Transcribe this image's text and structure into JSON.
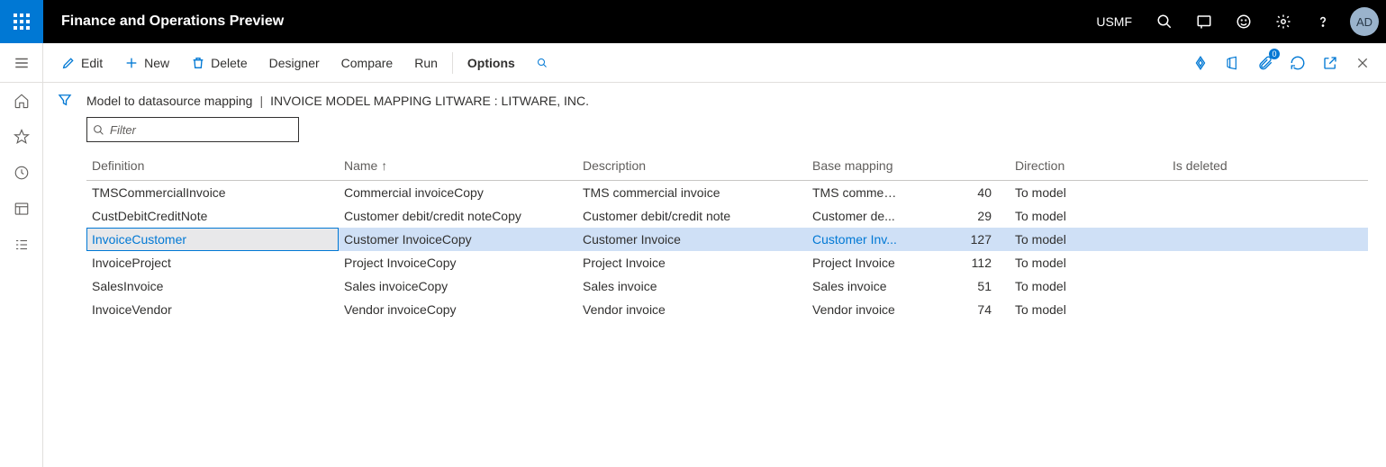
{
  "header": {
    "app_title": "Finance and Operations Preview",
    "company": "USMF",
    "avatar": "AD"
  },
  "cmd": {
    "edit": "Edit",
    "new": "New",
    "delete": "Delete",
    "designer": "Designer",
    "compare": "Compare",
    "run": "Run",
    "options": "Options",
    "attach_badge": "0"
  },
  "breadcrumb": {
    "page": "Model to datasource mapping",
    "detail": "INVOICE MODEL MAPPING LITWARE : LITWARE, INC."
  },
  "filter": {
    "placeholder": "Filter"
  },
  "columns": {
    "definition": "Definition",
    "name": "Name",
    "description": "Description",
    "base_mapping": "Base mapping",
    "direction": "Direction",
    "is_deleted": "Is deleted"
  },
  "rows": [
    {
      "definition": "TMSCommercialInvoice",
      "name": "Commercial invoiceCopy",
      "description": "TMS commercial invoice",
      "base_mapping": "TMS commer...",
      "num": "40",
      "direction": "To model",
      "selected": false
    },
    {
      "definition": "CustDebitCreditNote",
      "name": "Customer debit/credit noteCopy",
      "description": "Customer debit/credit note",
      "base_mapping": "Customer de...",
      "num": "29",
      "direction": "To model",
      "selected": false
    },
    {
      "definition": "InvoiceCustomer",
      "name": "Customer InvoiceCopy",
      "description": "Customer Invoice",
      "base_mapping": "Customer Inv...",
      "num": "127",
      "direction": "To model",
      "selected": true
    },
    {
      "definition": "InvoiceProject",
      "name": "Project InvoiceCopy",
      "description": "Project Invoice",
      "base_mapping": "Project Invoice",
      "num": "112",
      "direction": "To model",
      "selected": false
    },
    {
      "definition": "SalesInvoice",
      "name": "Sales invoiceCopy",
      "description": "Sales invoice",
      "base_mapping": "Sales invoice",
      "num": "51",
      "direction": "To model",
      "selected": false
    },
    {
      "definition": "InvoiceVendor",
      "name": "Vendor invoiceCopy",
      "description": "Vendor invoice",
      "base_mapping": "Vendor invoice",
      "num": "74",
      "direction": "To model",
      "selected": false
    }
  ]
}
